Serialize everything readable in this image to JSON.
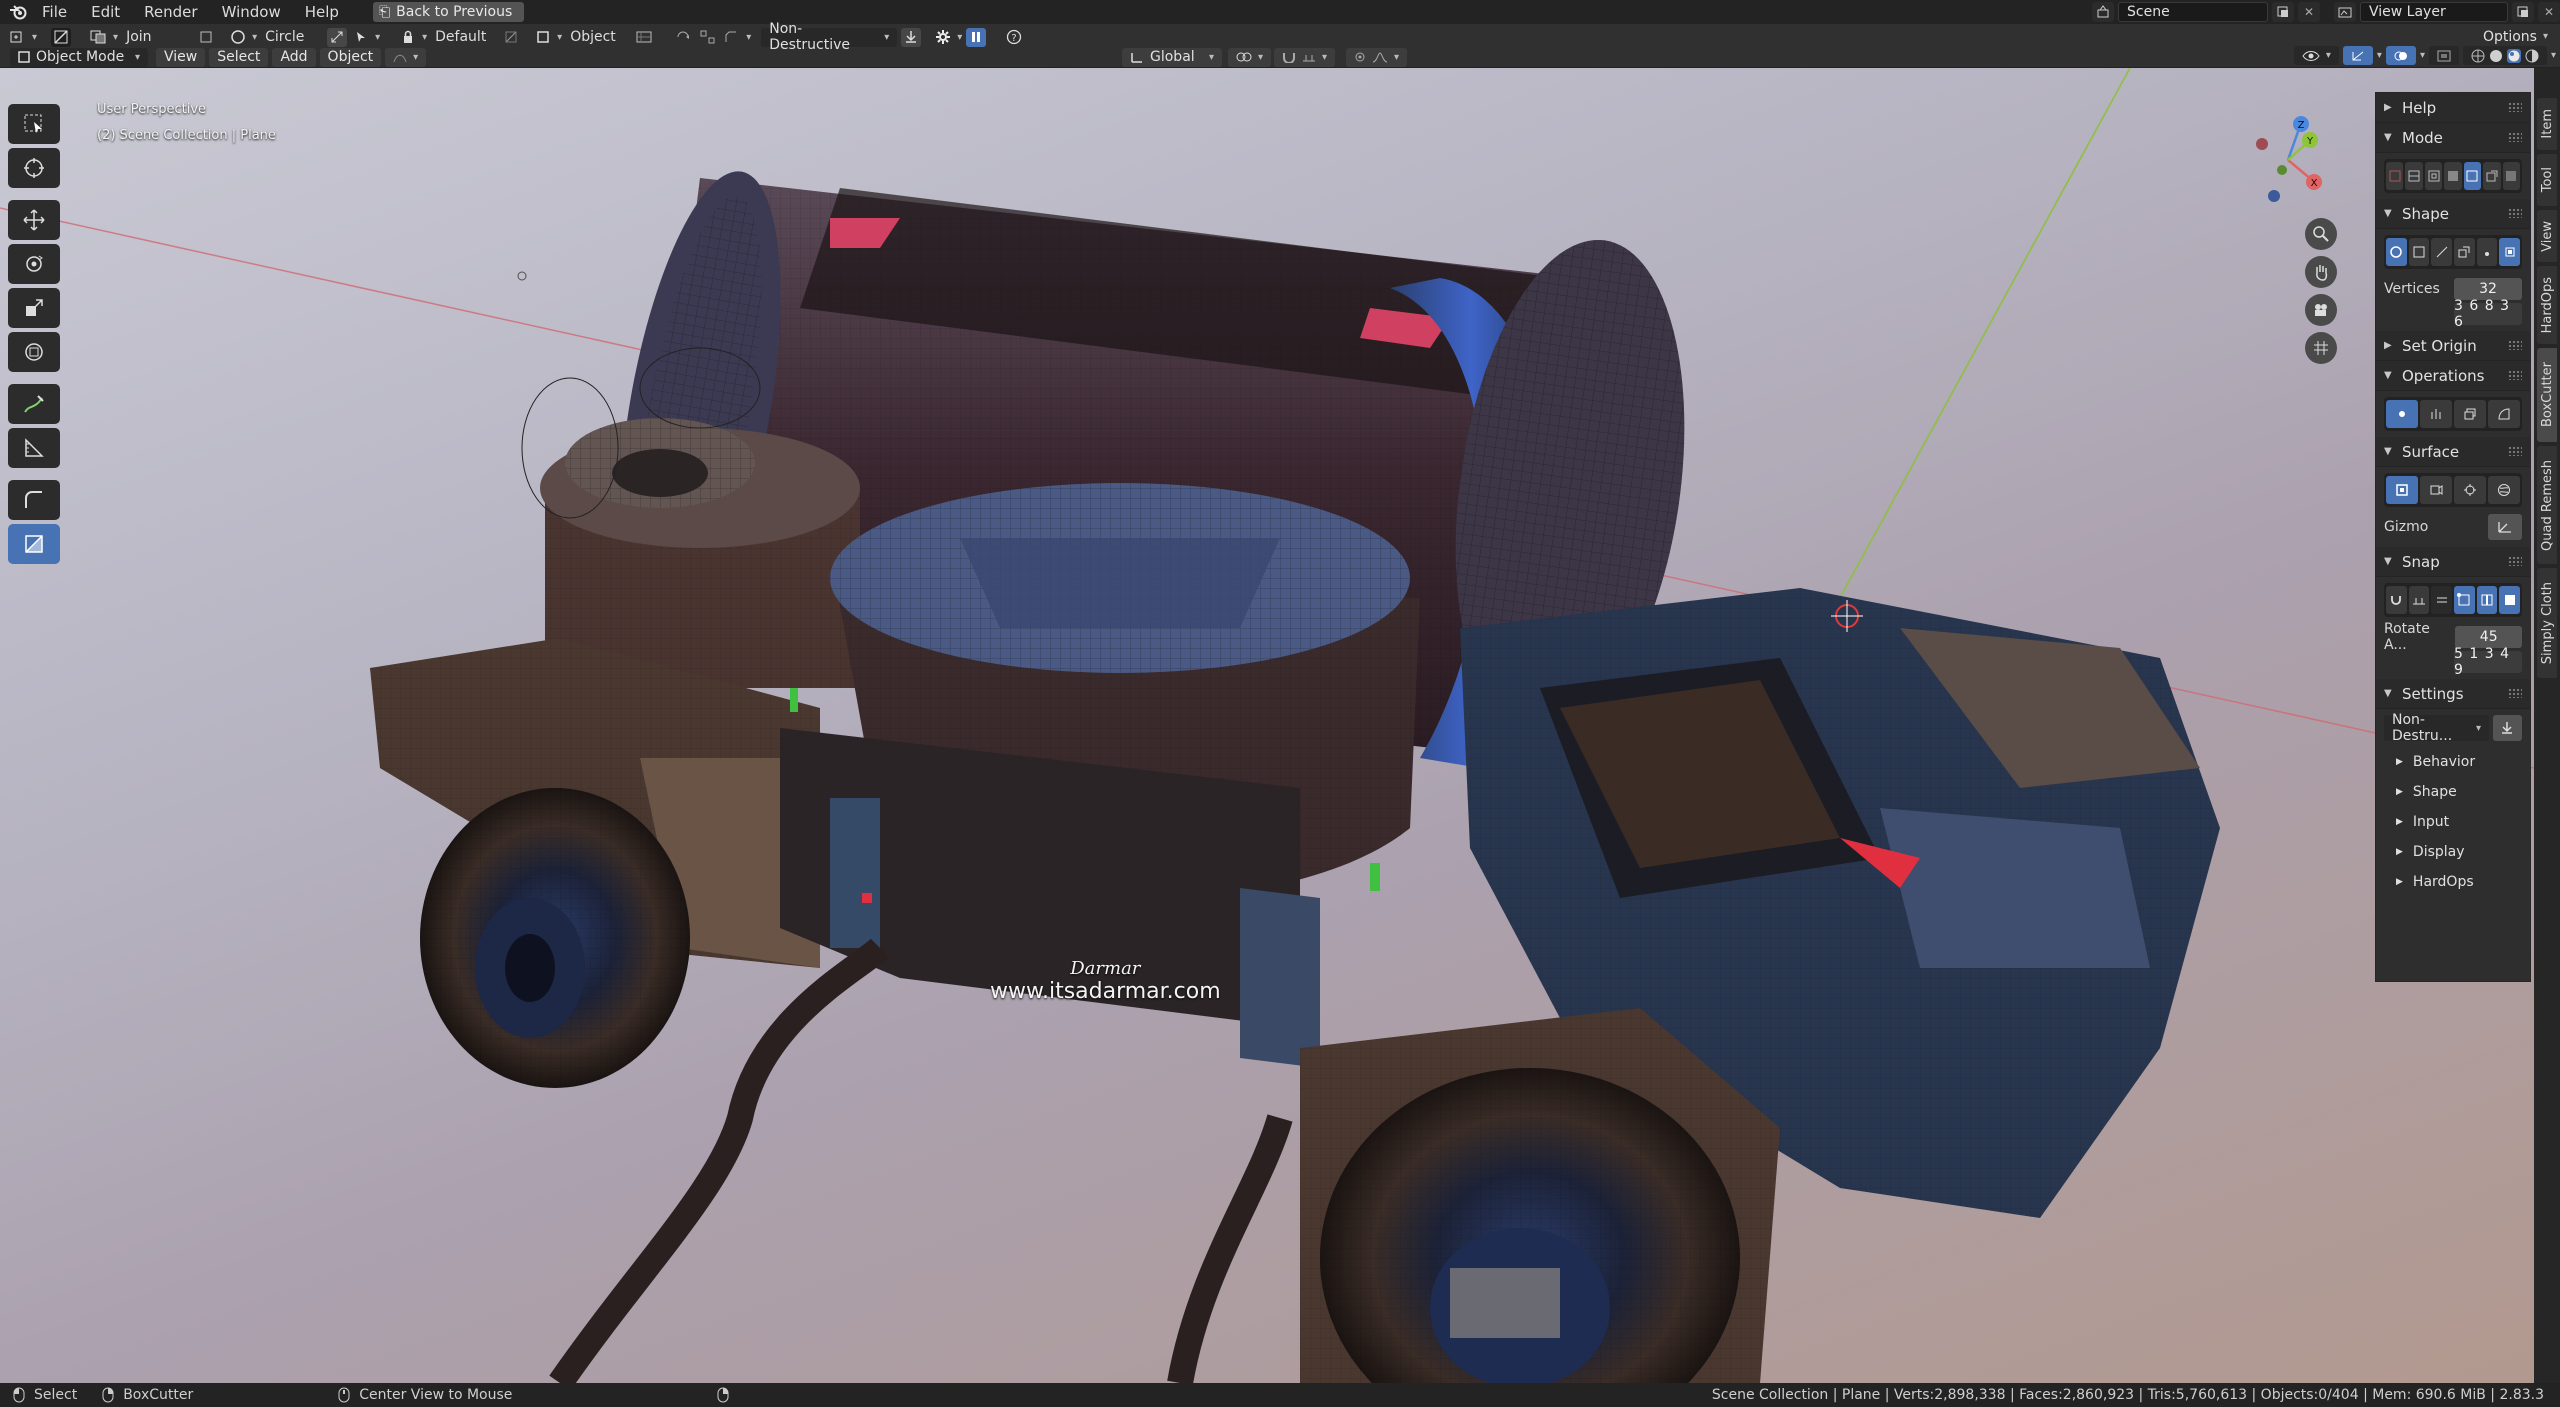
{
  "menubar": {
    "items": [
      "File",
      "Edit",
      "Render",
      "Window",
      "Help"
    ],
    "back_button": "Back to Previous",
    "scene": "Scene",
    "view_layer": "View Layer"
  },
  "tool_settings": {
    "boolean_mode": "Join",
    "shape": "Circle",
    "origin": "Default",
    "target": "Object",
    "mode": "Non-Destructive",
    "options": "Options"
  },
  "header": {
    "interaction_mode": "Object Mode",
    "menus": [
      "View",
      "Select",
      "Add",
      "Object"
    ],
    "transform_orientation": "Global"
  },
  "viewport": {
    "perspective": "User Perspective",
    "collection": "(2) Scene Collection | Plane",
    "watermark_signature": "Darmar",
    "watermark_url": "www.itsadarmar.com"
  },
  "npanel": {
    "help": "Help",
    "mode": "Mode",
    "shape": "Shape",
    "vertices_label": "Vertices",
    "vertices_value": "32",
    "vertices_presets": "3 6 8 3 6",
    "set_origin": "Set Origin",
    "operations": "Operations",
    "surface": "Surface",
    "gizmo": "Gizmo",
    "snap": "Snap",
    "rotate_label": "Rotate A...",
    "rotate_value": "45",
    "rotate_presets": "5 1 3 4 9",
    "settings": "Settings",
    "settings_dropdown": "Non-Destru...",
    "sub_items": [
      "Behavior",
      "Shape",
      "Input",
      "Display",
      "HardOps"
    ]
  },
  "side_tabs": [
    "Item",
    "Tool",
    "View",
    "HardOps",
    "BoxCutter",
    "Quad Remesh",
    "Simply Cloth"
  ],
  "statusbar": {
    "select": "Select",
    "tool": "BoxCutter",
    "center_view": "Center View to Mouse",
    "stats": "Scene Collection | Plane | Verts:2,898,338 | Faces:2,860,923 | Tris:5,760,613 | Objects:0/404 | Mem: 690.6 MiB | 2.83.3"
  },
  "colors": {
    "accent": "#4772b3",
    "ui_bg": "#303030",
    "x_axis": "#e06464",
    "y_axis": "#8fc43a",
    "z_axis": "#4a88e0"
  }
}
